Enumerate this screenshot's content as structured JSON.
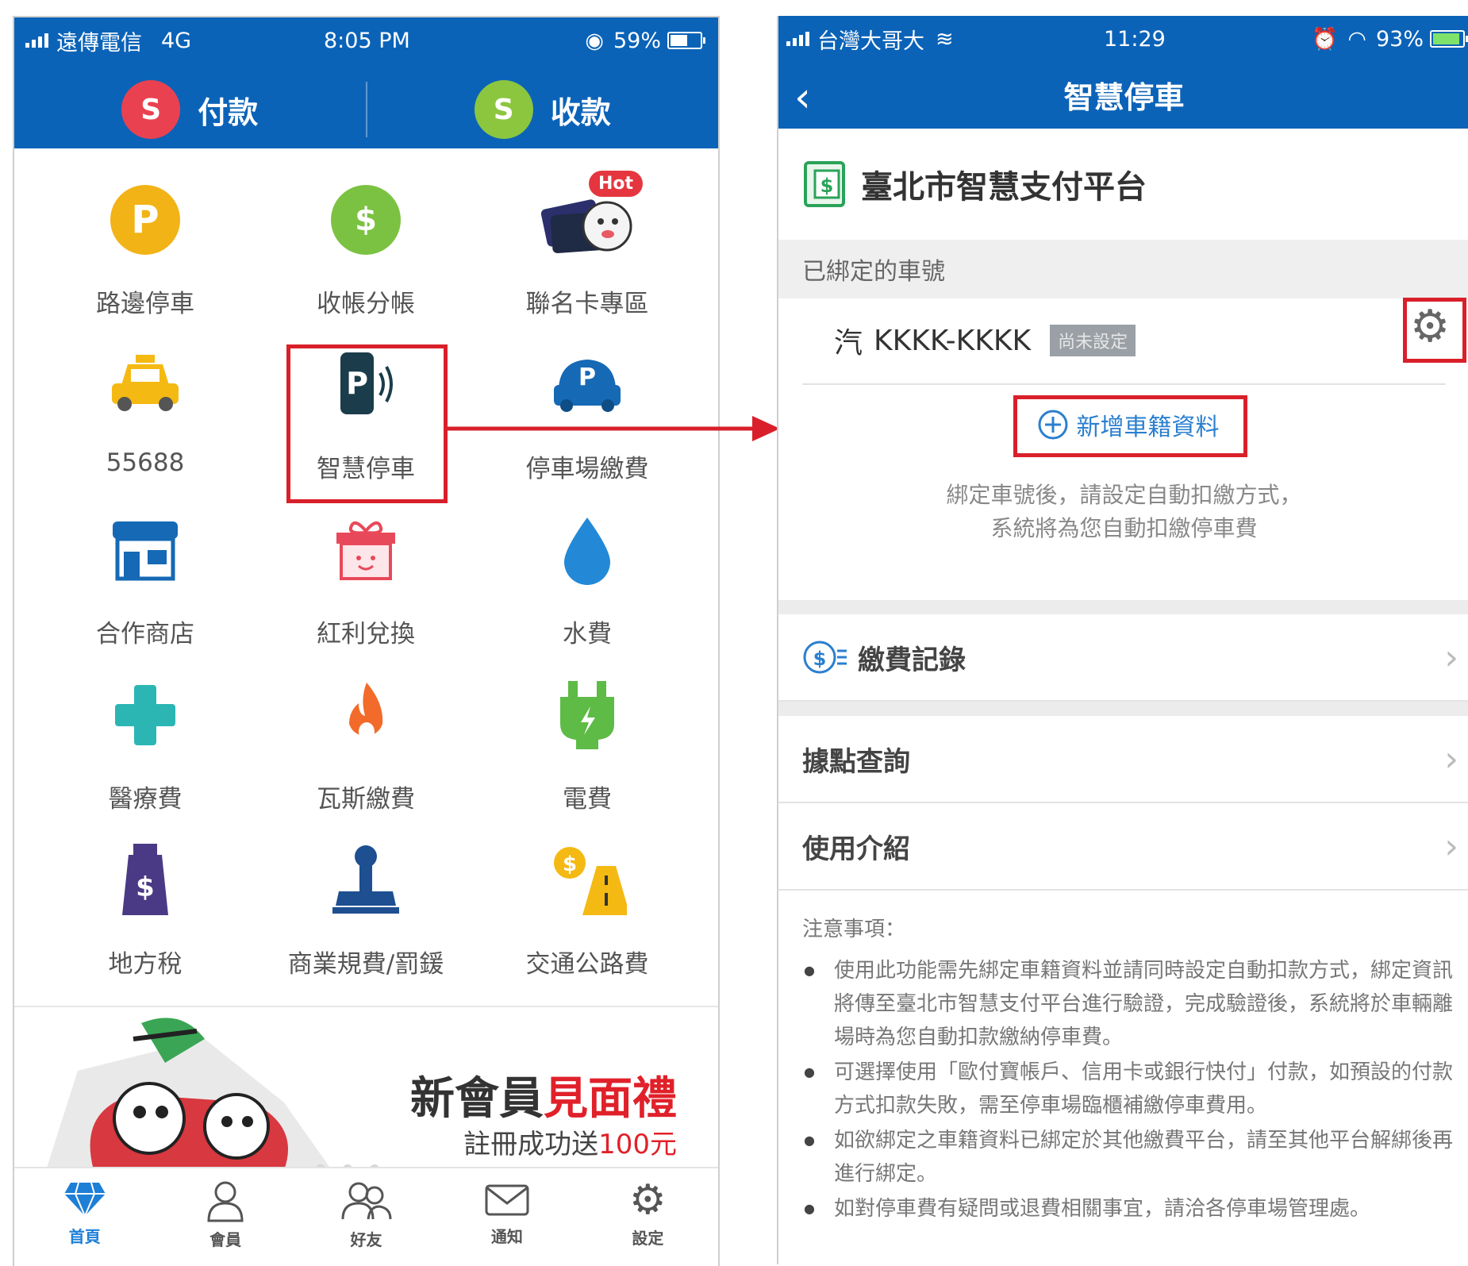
{
  "left": {
    "status": {
      "carrier": "遠傳電信",
      "network": "4G",
      "time": "8:05 PM",
      "battery": "59%",
      "battery_level": 0.59
    },
    "header": {
      "pay_label": "付款",
      "receive_label": "收款"
    },
    "grid": [
      {
        "label": "路邊停車",
        "icon": "parking-coin-icon"
      },
      {
        "label": "收帳分帳",
        "icon": "split-bill-icon"
      },
      {
        "label": "聯名卡專區",
        "icon": "cobrand-card-icon",
        "badge": "Hot"
      },
      {
        "label": "55688",
        "icon": "taxi-icon"
      },
      {
        "label": "智慧停車",
        "icon": "smart-parking-icon"
      },
      {
        "label": "停車場繳費",
        "icon": "parking-lot-icon"
      },
      {
        "label": "合作商店",
        "icon": "store-icon"
      },
      {
        "label": "紅利兌換",
        "icon": "gift-icon"
      },
      {
        "label": "水費",
        "icon": "water-drop-icon"
      },
      {
        "label": "醫療費",
        "icon": "medical-cross-icon"
      },
      {
        "label": "瓦斯繳費",
        "icon": "gas-flame-icon"
      },
      {
        "label": "電費",
        "icon": "electric-plug-icon"
      },
      {
        "label": "地方稅",
        "icon": "tax-building-icon"
      },
      {
        "label": "商業規費/罰鍰",
        "icon": "stamp-icon"
      },
      {
        "label": "交通公路費",
        "icon": "toll-road-icon"
      }
    ],
    "banner": {
      "line1_a": "新會員",
      "line1_b": "見面禮",
      "line2_a": "註冊成功送",
      "line2_b": "100元"
    },
    "tabs": [
      {
        "label": "首頁",
        "icon": "diamond-home-icon"
      },
      {
        "label": "會員",
        "icon": "member-icon"
      },
      {
        "label": "好友",
        "icon": "friends-icon"
      },
      {
        "label": "通知",
        "icon": "mail-icon"
      },
      {
        "label": "設定",
        "icon": "gear-icon"
      }
    ]
  },
  "right": {
    "status": {
      "carrier": "台灣大哥大",
      "time": "11:29",
      "battery": "93%",
      "battery_level": 0.93
    },
    "nav": {
      "back": "‹",
      "title": "智慧停車"
    },
    "platform": "臺北市智慧支付平台",
    "bound_header": "已綁定的車號",
    "plate": {
      "type": "汽",
      "number": "KKKK-KKKK",
      "badge": "尚未設定"
    },
    "add_car": "新增車籍資料",
    "hint_1": "綁定車號後，請設定自動扣繳方式，",
    "hint_2": "系統將為您自動扣繳停車費",
    "menu": [
      "繳費記錄",
      "據點查詢",
      "使用介紹"
    ],
    "notes_title": "注意事項：",
    "notes": [
      "使用此功能需先綁定車籍資料並請同時設定自動扣款方式，綁定資訊將傳至臺北市智慧支付平台進行驗證，完成驗證後，系統將於車輛離場時為您自動扣款繳納停車費。",
      "可選擇使用「歐付寶帳戶、信用卡或銀行快付」付款，如預設的付款方式扣款失敗，需至停車場臨櫃補繳停車費用。",
      "如欲綁定之車籍資料已綁定於其他繳費平台，請至其他平台解綁後再進行綁定。",
      "如對停車費有疑問或退費相關事宜，請洽各停車場管理處。"
    ]
  },
  "colors": {
    "brand_blue": "#0b63b8",
    "highlight_red": "#d9202a"
  }
}
